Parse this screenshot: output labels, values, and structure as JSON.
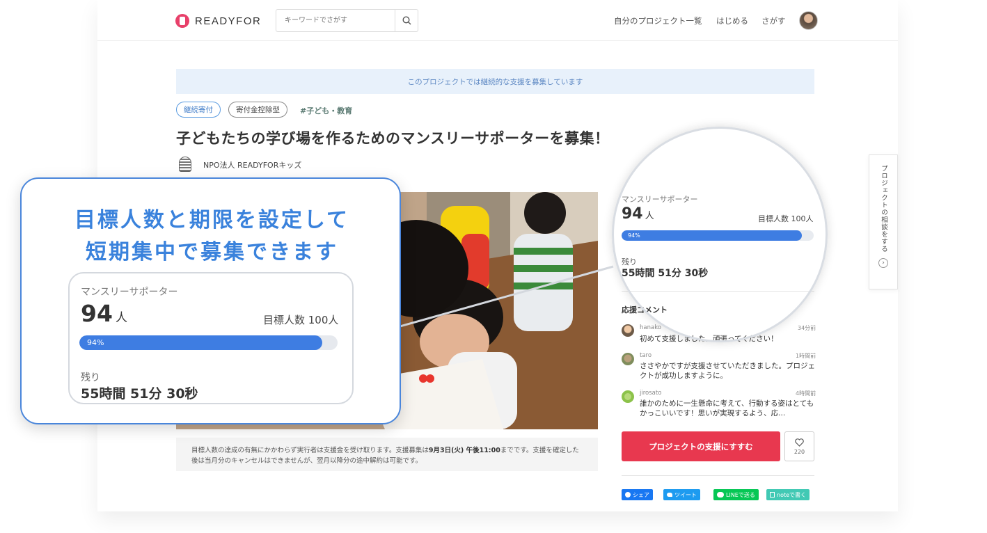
{
  "brand": {
    "name": "READYFOR",
    "accent": "#e8406a"
  },
  "search": {
    "placeholder": "キーワードでさがす",
    "icon": "search-icon"
  },
  "nav": {
    "my_projects": "自分のプロジェクト一覧",
    "start": "はじめる",
    "browse": "さがす"
  },
  "notice": "このプロジェクトでは継続的な支援を募集しています",
  "tags": {
    "continuous": "継続寄付",
    "deduction": "寄付金控除型",
    "category": "#子ども・教育"
  },
  "project": {
    "title": "子どもたちの学び場を作るためのマンスリーサポーターを募集！",
    "org": "NPO法人 READYFORキッズ"
  },
  "disclaimer": {
    "part1": "目標人数の達成の有無にかかわらず実行者は支援金を受け取ります。支援募集は",
    "deadline": "9月3日(火) 午後11:00",
    "part2": "までです。支援を確定した後は当月分のキャンセルはできませんが、翌月以降分の途中解約は可能です。"
  },
  "stats": {
    "supporters_label": "マンスリーサポーター",
    "supporters_count": "94",
    "unit": "人",
    "goal": "目標人数 100人",
    "progress_label": "94%",
    "progress_fraction": 0.94,
    "remaining_label": "残り",
    "remaining_value": "55時間 51分 30秒"
  },
  "comments": {
    "heading": "応援コメント",
    "items": [
      {
        "user": "hanako",
        "time": "34分前",
        "text": "初めて支援しました。頑張ってください！"
      },
      {
        "user": "taro",
        "time": "1時間前",
        "text": "ささやかですが支援させていただきました。プロジェクトが成功しますように。"
      },
      {
        "user": "jirosato",
        "time": "4時間前",
        "text": "誰かのために一生懸命に考えて、行動する姿はとてもかっこいいです！思いが実現するよう、応..."
      }
    ]
  },
  "actions": {
    "support": "プロジェクトの支援にすすむ",
    "favorite_count": "220"
  },
  "share": {
    "facebook": "シェア",
    "twitter": "ツイート",
    "line": "LINEで送る",
    "note": "noteで書く"
  },
  "consult_tab": {
    "label": "プロジェクトの相談をする"
  },
  "callout": {
    "line1": "目標人数と期限を設定して",
    "line2": "短期集中で募集できます"
  },
  "colors": {
    "primary_blue": "#3e7de2",
    "support_red": "#e8384f",
    "callout_blue": "#3a82dc"
  }
}
